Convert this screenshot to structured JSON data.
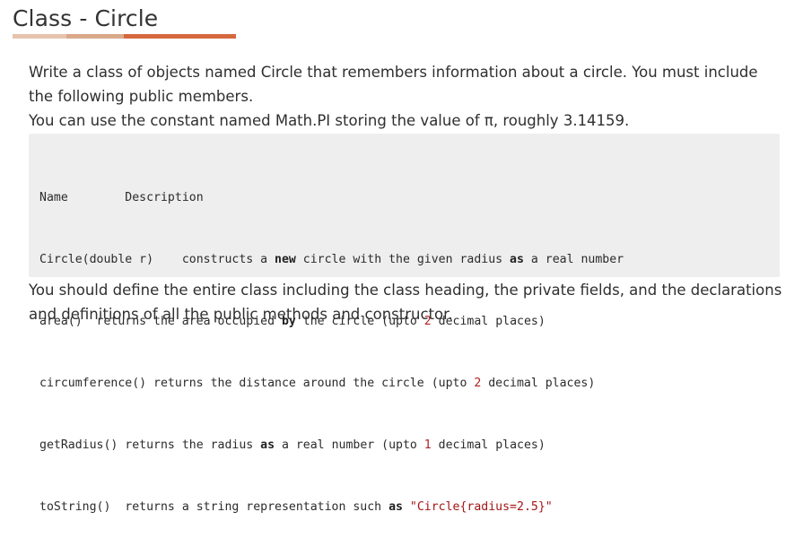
{
  "page": {
    "title": "Class - Circle",
    "underline_colors": [
      "#e6c3ad",
      "#d9a98a",
      "#d4683e"
    ]
  },
  "intro": {
    "line1": "Write a class of objects named Circle that remembers information about a circle. You must include the following public members.",
    "line2": "You can use the constant named Math.PI storing the value of π, roughly 3.14159."
  },
  "table": {
    "header_name": "Name",
    "header_desc": "Description",
    "rows": [
      {
        "name": "Circle(double r)",
        "parts": [
          {
            "t": "constructs a ",
            "k": "txt"
          },
          {
            "t": "new",
            "k": "kw"
          },
          {
            "t": " circle with the given radius ",
            "k": "txt"
          },
          {
            "t": "as",
            "k": "kw"
          },
          {
            "t": " a real number",
            "k": "txt"
          }
        ]
      },
      {
        "name": "area()",
        "parts": [
          {
            "t": "returns the area occupied ",
            "k": "txt"
          },
          {
            "t": "by",
            "k": "kw"
          },
          {
            "t": " the circle (upto ",
            "k": "txt"
          },
          {
            "t": "2",
            "k": "num"
          },
          {
            "t": " decimal places)",
            "k": "txt"
          }
        ]
      },
      {
        "name": "circumference()",
        "parts": [
          {
            "t": "returns the distance around the circle (upto ",
            "k": "txt"
          },
          {
            "t": "2",
            "k": "num"
          },
          {
            "t": " decimal places)",
            "k": "txt"
          }
        ]
      },
      {
        "name": "getRadius()",
        "parts": [
          {
            "t": "returns the radius ",
            "k": "txt"
          },
          {
            "t": "as",
            "k": "kw"
          },
          {
            "t": " a real number (upto ",
            "k": "txt"
          },
          {
            "t": "1",
            "k": "num"
          },
          {
            "t": " decimal places)",
            "k": "txt"
          }
        ]
      },
      {
        "name": "toString()",
        "parts": [
          {
            "t": "returns a string representation such ",
            "k": "txt"
          },
          {
            "t": "as",
            "k": "kw"
          },
          {
            "t": " ",
            "k": "txt"
          },
          {
            "t": "\"Circle{radius=2.5}\"",
            "k": "str"
          }
        ]
      }
    ]
  },
  "closing": {
    "text": "You should define the entire class including the class heading, the private fields, and the declarations and definitions of all the public methods and constructor."
  }
}
